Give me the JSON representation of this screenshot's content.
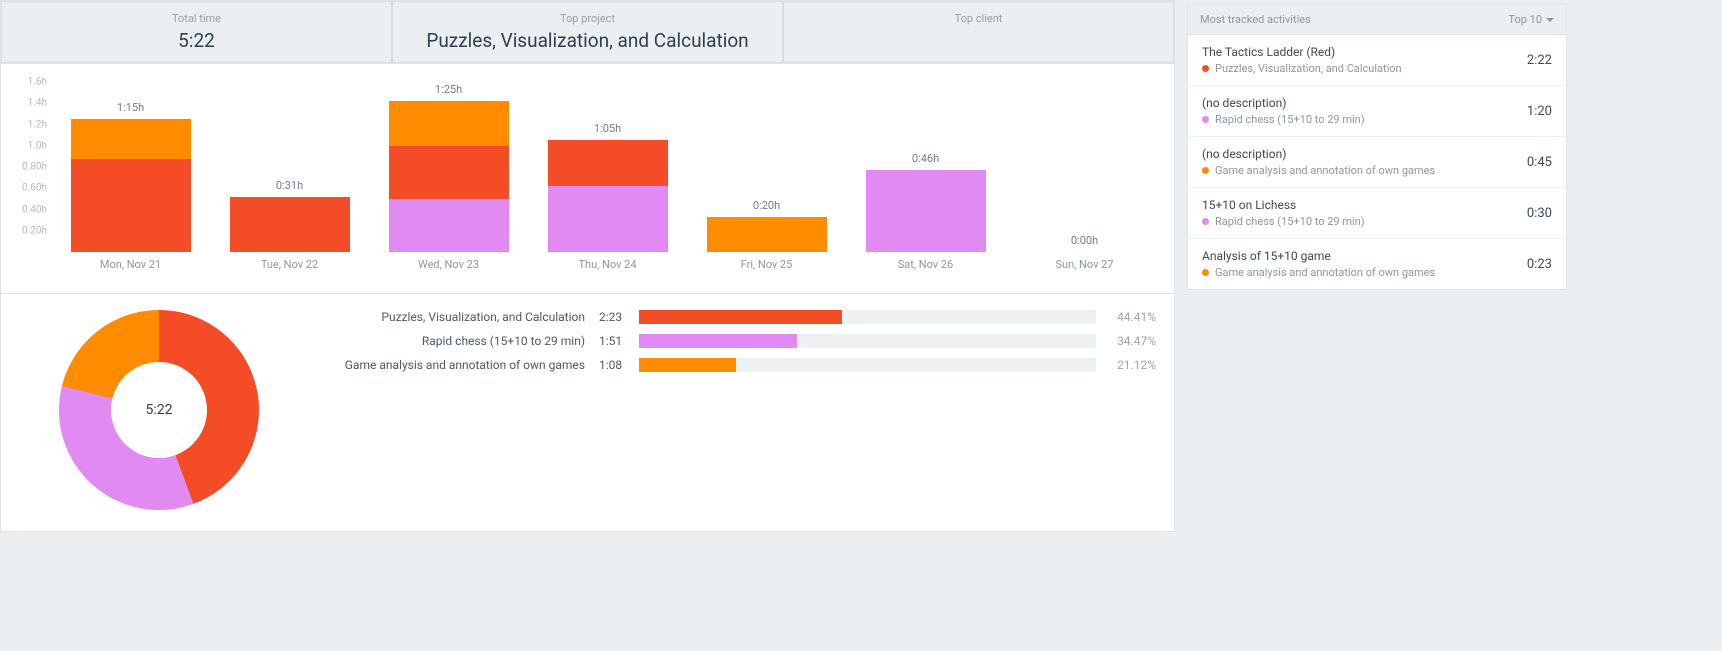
{
  "colors": {
    "puzzles": "#f44c27",
    "rapid": "#e08af2",
    "analysis": "#ff8c00"
  },
  "summary": {
    "total_time_label": "Total time",
    "total_time_value": "5:22",
    "top_project_label": "Top project",
    "top_project_value": "Puzzles, Visualization, and Calculation",
    "top_client_label": "Top client",
    "top_client_value": ""
  },
  "chart_data": {
    "type": "bar",
    "ylabel": "h",
    "ylim": [
      0,
      1.6
    ],
    "y_ticks": [
      "1.6h",
      "1.4h",
      "1.2h",
      "1.0h",
      "0.80h",
      "0.60h",
      "0.40h",
      "0.20h"
    ],
    "categories": [
      "Mon, Nov 21",
      "Tue, Nov 22",
      "Wed, Nov 23",
      "Thu, Nov 24",
      "Fri, Nov 25",
      "Sat, Nov 26",
      "Sun, Nov 27"
    ],
    "totals_labels": [
      "1:15h",
      "0:31h",
      "1:25h",
      "1:05h",
      "0:20h",
      "0:46h",
      "0:00h"
    ],
    "series": [
      {
        "name": "Puzzles, Visualization, and Calculation",
        "color": "#f44c27",
        "values": [
          0.88,
          0.52,
          0.5,
          0.43,
          0.0,
          0.0,
          0.0
        ]
      },
      {
        "name": "Game analysis and annotation of own games",
        "color": "#ff8c00",
        "values": [
          0.37,
          0.0,
          0.42,
          0.0,
          0.33,
          0.0,
          0.0
        ]
      },
      {
        "name": "Rapid chess (15+10 to 29 min)",
        "color": "#e08af2",
        "values": [
          0.0,
          0.0,
          0.5,
          0.62,
          0.0,
          0.77,
          0.0
        ]
      }
    ],
    "donut": {
      "center": "5:22",
      "slices": [
        {
          "name": "Puzzles, Visualization, and Calculation",
          "pct": 44.41,
          "color": "#f44c27"
        },
        {
          "name": "Rapid chess (15+10 to 29 min)",
          "pct": 34.47,
          "color": "#e08af2"
        },
        {
          "name": "Game analysis and annotation of own games",
          "pct": 21.12,
          "color": "#ff8c00"
        }
      ]
    }
  },
  "breakdown": [
    {
      "name": "Puzzles, Visualization, and Calculation",
      "time": "2:23",
      "pct": 44.41,
      "pct_label": "44.41%",
      "color": "#f44c27"
    },
    {
      "name": "Rapid chess (15+10 to 29 min)",
      "time": "1:51",
      "pct": 34.47,
      "pct_label": "34.47%",
      "color": "#e08af2"
    },
    {
      "name": "Game analysis and annotation of own games",
      "time": "1:08",
      "pct": 21.12,
      "pct_label": "21.12%",
      "color": "#ff8c00"
    }
  ],
  "side": {
    "title": "Most tracked activities",
    "selector": "Top 10",
    "items": [
      {
        "title": "The Tactics Ladder (Red)",
        "project": "Puzzles, Visualization, and Calculation",
        "color": "#f44c27",
        "time": "2:22"
      },
      {
        "title": "(no description)",
        "project": "Rapid chess (15+10 to 29 min)",
        "color": "#e08af2",
        "time": "1:20"
      },
      {
        "title": "(no description)",
        "project": "Game analysis and annotation of own games",
        "color": "#ff8c00",
        "time": "0:45"
      },
      {
        "title": "15+10 on Lichess",
        "project": "Rapid chess (15+10 to 29 min)",
        "color": "#e08af2",
        "time": "0:30"
      },
      {
        "title": "Analysis of 15+10 game",
        "project": "Game analysis and annotation of own games",
        "color": "#ff8c00",
        "time": "0:23"
      }
    ]
  }
}
